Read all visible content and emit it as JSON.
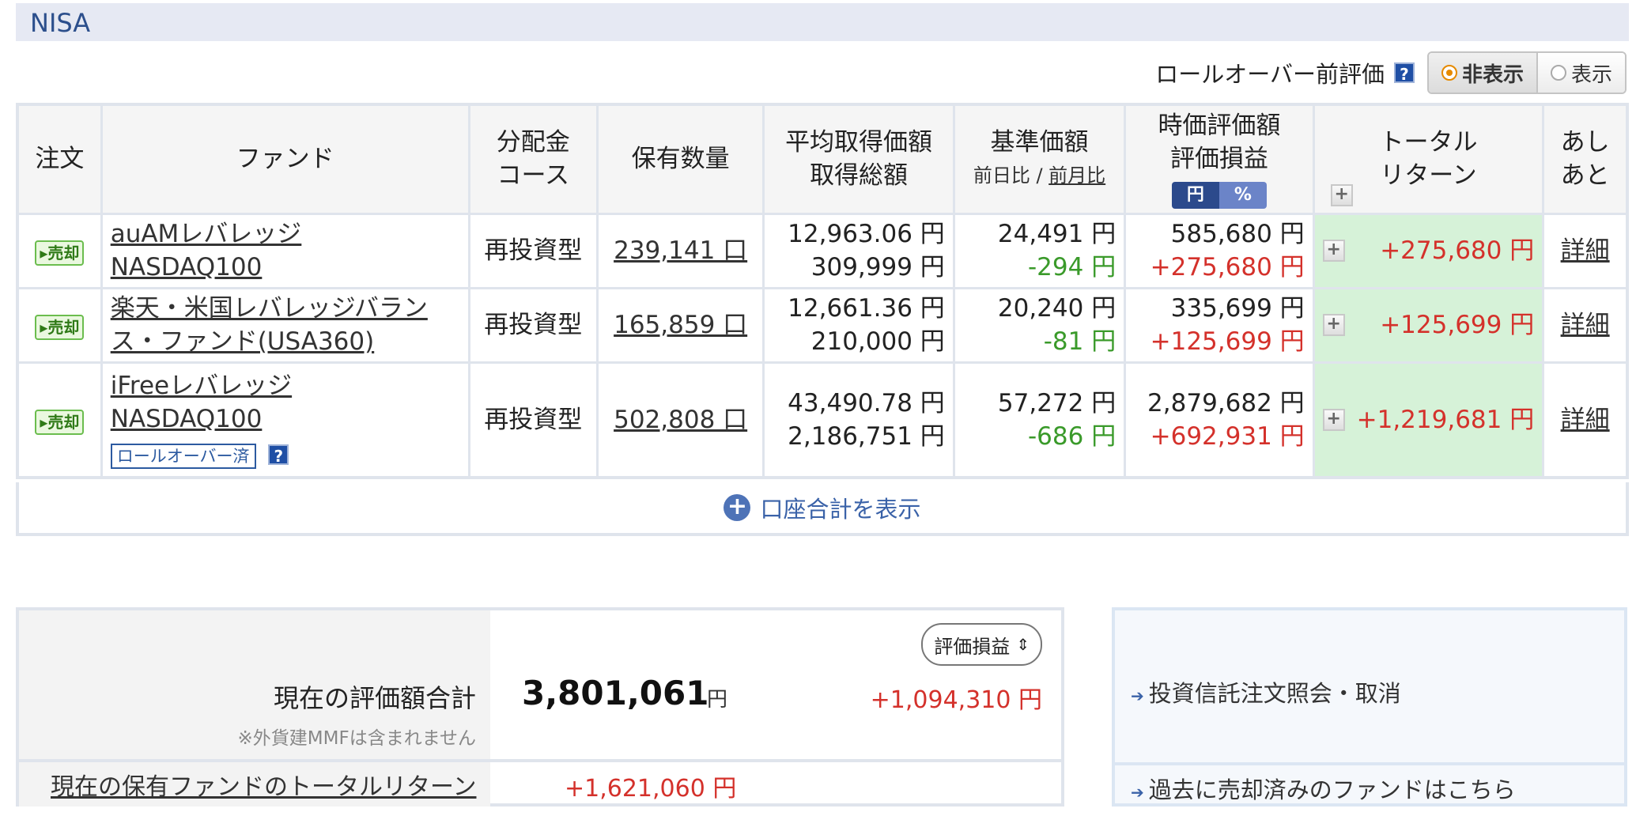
{
  "section": {
    "title": "NISA"
  },
  "rollover": {
    "label": "ロールオーバー前評価",
    "help_icon": "?",
    "options": [
      "非表示",
      "表示"
    ],
    "selected": "非表示"
  },
  "table": {
    "headers": {
      "order": "注文",
      "fund": "ファンド",
      "dist_1": "分配金",
      "dist_2": "コース",
      "qty": "保有数量",
      "avg_1": "平均取得価額",
      "avg_2": "取得総額",
      "base_1": "基準価額",
      "base_2a": "前日比",
      "base_sep": " / ",
      "base_2b": "前月比",
      "mkt_1": "時価評価額",
      "mkt_2": "評価損益",
      "unit_yen": "円",
      "unit_pct": "%",
      "total_1": "トータル",
      "total_2": "リターン",
      "hist_1": "あし",
      "hist_2": "あと"
    },
    "rows": [
      {
        "sell": "▸売却",
        "fund_line1": "auAMレバレッジ",
        "fund_line2": "NASDAQ100",
        "course": "再投資型",
        "qty": "239,141 口",
        "avg_price": "12,963.06 円",
        "cost_total": "309,999 円",
        "base_price": "24,491 円",
        "base_change": "-294 円",
        "market_value": "585,680 円",
        "pl": "+275,680 円",
        "total_return": "+275,680 円",
        "detail": "詳細"
      },
      {
        "sell": "▸売却",
        "fund_line1": "楽天・米国レバレッジバラン",
        "fund_line2": "ス・ファンド(USA360)",
        "course": "再投資型",
        "qty": "165,859 口",
        "avg_price": "12,661.36 円",
        "cost_total": "210,000 円",
        "base_price": "20,240 円",
        "base_change": "-81 円",
        "market_value": "335,699 円",
        "pl": "+125,699 円",
        "total_return": "+125,699 円",
        "detail": "詳細"
      },
      {
        "sell": "▸売却",
        "fund_line1": "iFreeレバレッジ",
        "fund_line2": "NASDAQ100",
        "badge": "ロールオーバー済",
        "course": "再投資型",
        "qty": "502,808 口",
        "avg_price": "43,490.78 円",
        "cost_total": "2,186,751 円",
        "base_price": "57,272 円",
        "base_change": "-686 円",
        "market_value": "2,879,682 円",
        "pl": "+692,931 円",
        "total_return": "+1,219,681 円",
        "detail": "詳細"
      }
    ],
    "show_account_total": "口座合計を表示"
  },
  "totals": {
    "label": "現在の評価額合計",
    "note": "※外貨建MMFは含まれません",
    "value": "3,801,061",
    "unit": "円",
    "gain": "+1,094,310 円",
    "sort_button": "評価損益",
    "total_return_label": "現在の保有ファンドのトータルリターン",
    "total_return_value": "+1,621,060 円"
  },
  "links": {
    "order_inquiry": "投資信託注文照会・取消",
    "past_sold": "過去に売却済みのファンドはこちら"
  },
  "colors": {
    "gain_red": "#d4312b",
    "loss_green": "#3a9a2a",
    "total_return_bg": "#d6f2d8",
    "header_blue": "#2c4f8c"
  }
}
